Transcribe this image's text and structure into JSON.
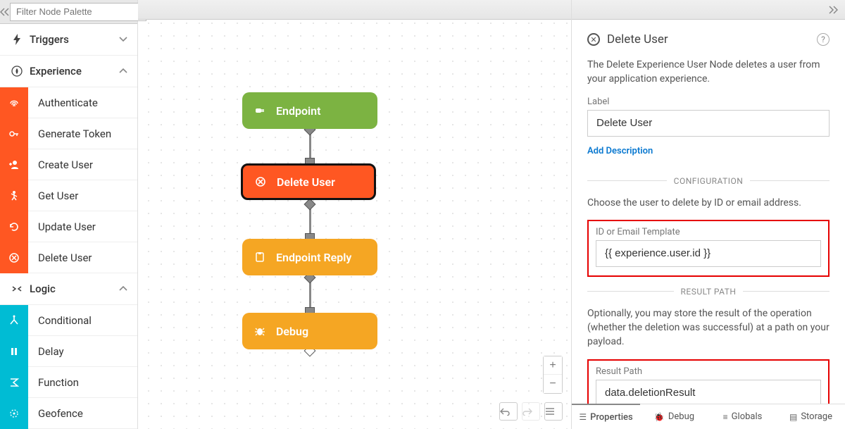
{
  "sidebar": {
    "filter_placeholder": "Filter Node Palette",
    "categories": [
      {
        "label": "Triggers",
        "expanded": false
      },
      {
        "label": "Experience",
        "expanded": true,
        "items": [
          {
            "label": "Authenticate",
            "icon": "fingerprint-icon"
          },
          {
            "label": "Generate Token",
            "icon": "key-icon"
          },
          {
            "label": "Create User",
            "icon": "add-user-icon"
          },
          {
            "label": "Get User",
            "icon": "run-user-icon"
          },
          {
            "label": "Update User",
            "icon": "refresh-icon"
          },
          {
            "label": "Delete User",
            "icon": "delete-icon"
          }
        ]
      },
      {
        "label": "Logic",
        "expanded": true,
        "items": [
          {
            "label": "Conditional",
            "icon": "branch-icon"
          },
          {
            "label": "Delay",
            "icon": "pause-icon"
          },
          {
            "label": "Function",
            "icon": "sigma-icon"
          },
          {
            "label": "Geofence",
            "icon": "geofence-icon"
          }
        ]
      }
    ]
  },
  "flow": {
    "nodes": [
      {
        "label": "Endpoint",
        "type": "trigger",
        "color": "green",
        "icon": "plug-icon"
      },
      {
        "label": "Delete User",
        "type": "experience",
        "color": "orange",
        "icon": "delete-icon",
        "selected": true
      },
      {
        "label": "Endpoint Reply",
        "type": "output",
        "color": "amber",
        "icon": "clipboard-icon"
      },
      {
        "label": "Debug",
        "type": "output",
        "color": "amber",
        "icon": "bug-icon"
      }
    ]
  },
  "panel": {
    "title": "Delete User",
    "description": "The Delete Experience User Node deletes a user from your application experience.",
    "label_field_label": "Label",
    "label_value": "Delete User",
    "add_description": "Add Description",
    "config_section": "CONFIGURATION",
    "config_desc": "Choose the user to delete by ID or email address.",
    "id_field_label": "ID or Email Template",
    "id_value": "{{ experience.user.id }}",
    "result_section": "RESULT PATH",
    "result_desc": "Optionally, you may store the result of the operation (whether the deletion was successful) at a path on your payload.",
    "result_field_label": "Result Path",
    "result_value": "data.deletionResult",
    "tabs": [
      {
        "label": "Properties",
        "icon": "list-icon"
      },
      {
        "label": "Debug",
        "icon": "bug-icon"
      },
      {
        "label": "Globals",
        "icon": "globe-icon"
      },
      {
        "label": "Storage",
        "icon": "storage-icon"
      }
    ]
  }
}
